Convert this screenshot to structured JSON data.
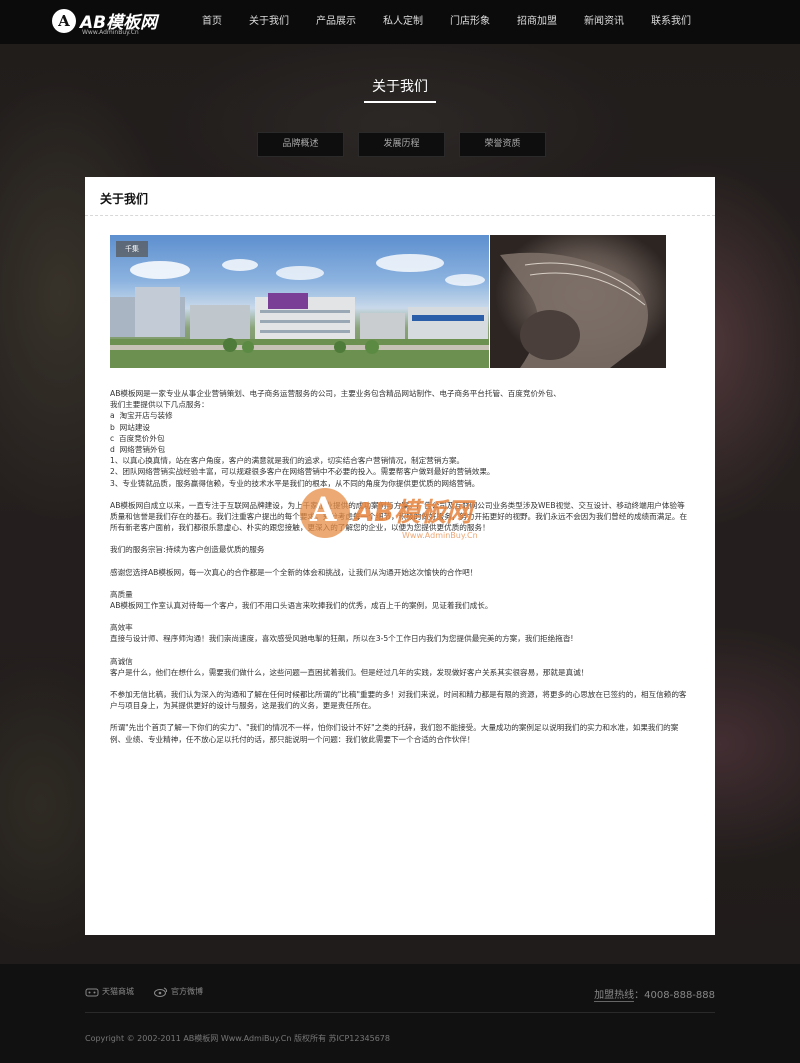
{
  "header": {
    "logo_text": "AB模板网",
    "logo_sub": "Www.AdminBuy.Cn",
    "nav": [
      "首页",
      "关于我们",
      "产品展示",
      "私人定制",
      "门店形象",
      "招商加盟",
      "新闻资讯",
      "联系我们"
    ]
  },
  "hero": {
    "title": "关于我们",
    "tabs": [
      "品牌概述",
      "发展历程",
      "荣誉资质"
    ]
  },
  "panel": {
    "heading": "关于我们",
    "photo_tag": "千集",
    "paragraphs": [
      "AB模板网是一家专业从事企业营销策划、电子商务运营服务的公司，主要业务包含精品网站制作、电子商务平台托管、百度竞价外包、",
      "我们主要提供以下几点服务：",
      "a  淘宝开店与装修",
      "b  网站建设",
      "c  百度竞价外包",
      "d  网络营销外包",
      "1、以真心换真情，站在客户角度，客户的满意就是我们的追求，切实结合客户营销情况，制定营销方案。",
      "2、团队网络营销实战经验丰富，可以规避很多客户在网络营销中不必要的投入。需要帮客户做到最好的营销效果。",
      "3、专业铸就品质，服务赢得信赖，专业的技术水平是我们的根本，从不同的角度为你提供更优质的网络营销。",
      "",
      "AB模板网自成立以来，一直专注于互联网品牌建设，为上千家企业提供的成功案例与方案，广告公司及互联网公司业务类型涉及WEB视觉、交互设计、移动终端用户体验等质量和信誉是我们存在的基石。我们注重客户提出的每个要求，充分考虑每一个细节，积极的做好服务，努力开拓更好的视野。我们永远不会因为我们曾经的成绩而满足。在所有新老客户面前，我们都很乐意虚心、朴实的跟您接触，更深入的了解您的企业，以便为您提供更优质的服务！",
      "",
      "我们的服务宗旨:持续为客户创造最优质的服务",
      "",
      "感谢您选择AB模板网，每一次真心的合作都是一个全新的体会和挑战，让我们从沟通开始这次愉快的合作吧！",
      "",
      "高质量",
      "AB模板网工作室认真对待每一个客户，我们不用口头语言来吹捧我们的优秀，成百上千的案例，见证着我们成长。",
      "",
      "高效率",
      "直接与设计师、程序师沟通！我们崇尚速度，喜欢感受风驰电掣的狂飙，所以在3-5个工作日内我们为您提供最完美的方案，我们拒绝拖沓!",
      "",
      "高诚信",
      "客户是什么，他们在想什么，需要我们做什么，这些问题一直困扰着我们。但是经过几年的实践，发现做好客户关系其实很容易，那就是真诚！",
      "",
      "不参加无信比稿，我们认为深入的沟通和了解在任何时候都比所谓的\"比稿\"重要的多！对我们来说，时间和精力都是有限的资源，将更多的心思放在已签约的，相互信赖的客户与项目身上，为其提供更好的设计与服务，这是我们的义务，更是责任所在。",
      "",
      "所谓\"先出个首页了解一下你们的实力\"、\"我们的情况不一样，怕你们设计不好\"之类的托辞，我们恕不能接受。大量成功的案例足以说明我们的实力和水准，如果我们的案例、业绩、专业精神，任不放心足以托付的话，那只能说明一个问题：我们彼此需要下一个合适的合作伙伴！"
    ]
  },
  "watermark": {
    "text": "AB模板网",
    "sub": "Www.AdminBuy.Cn"
  },
  "footer": {
    "links": [
      "天猫商城",
      "官方微博"
    ],
    "hotline_label": "加盟热线",
    "hotline_number": "：4008-888-888",
    "copyright": "Copyright © 2002-2011 AB模板网 Www.AdmiBuy.Cn 版权所有  苏ICP12345678"
  }
}
